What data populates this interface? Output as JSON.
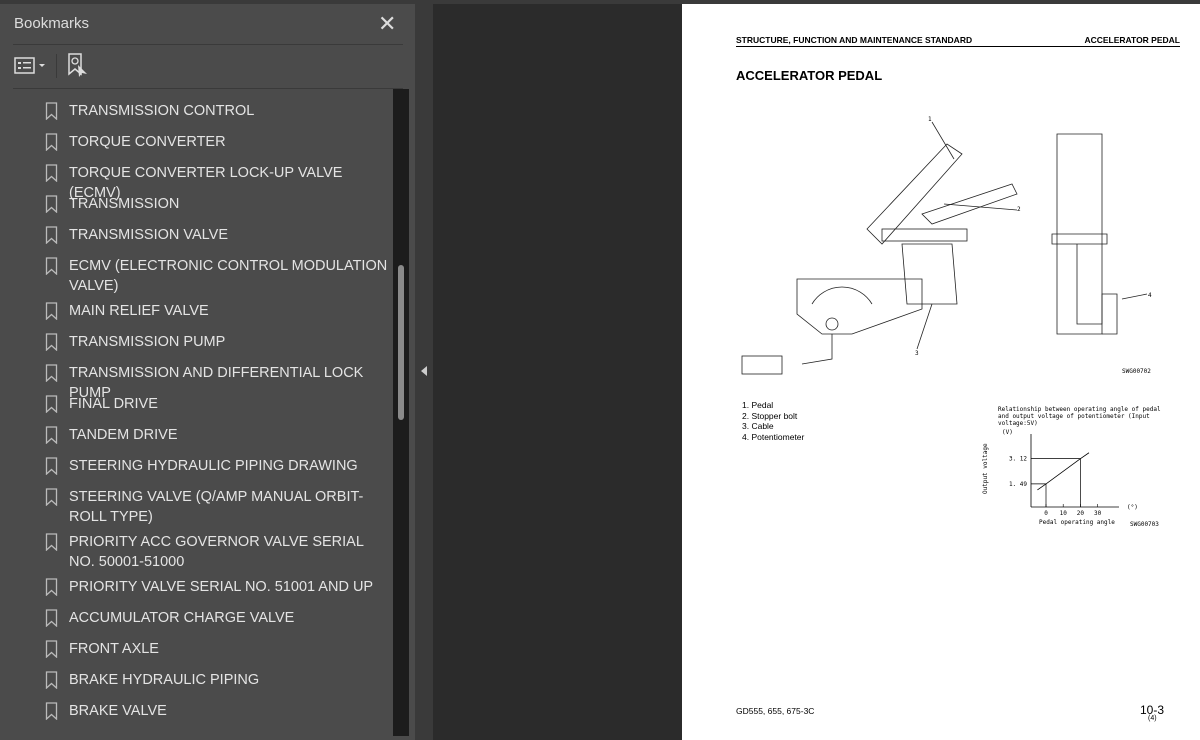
{
  "sidebar": {
    "title": "Bookmarks",
    "close": "✕",
    "items": [
      {
        "label": "TRANSMISSION CONTROL"
      },
      {
        "label": "TORQUE CONVERTER"
      },
      {
        "label": "TORQUE CONVERTER LOCK-UP VALVE (ECMV)"
      },
      {
        "label": "TRANSMISSION"
      },
      {
        "label": "TRANSMISSION VALVE"
      },
      {
        "label": "ECMV (ELECTRONIC CONTROL MODULATION VALVE)"
      },
      {
        "label": "MAIN RELIEF VALVE"
      },
      {
        "label": "TRANSMISSION PUMP"
      },
      {
        "label": "TRANSMISSION AND DIFFERENTIAL LOCK PUMP"
      },
      {
        "label": "FINAL DRIVE"
      },
      {
        "label": "TANDEM DRIVE"
      },
      {
        "label": "STEERING HYDRAULIC PIPING DRAWING"
      },
      {
        "label": "STEERING VALVE (Q/AMP MANUAL ORBIT-ROLL TYPE)"
      },
      {
        "label": "PRIORITY ACC GOVERNOR VALVE SERIAL NO. 50001-51000"
      },
      {
        "label": "PRIORITY VALVE SERIAL NO. 51001 AND UP"
      },
      {
        "label": "ACCUMULATOR CHARGE VALVE"
      },
      {
        "label": "FRONT AXLE"
      },
      {
        "label": "BRAKE HYDRAULIC PIPING"
      },
      {
        "label": "BRAKE VALVE"
      }
    ]
  },
  "page": {
    "header_left": "STRUCTURE, FUNCTION AND MAINTENANCE STANDARD",
    "header_right": "ACCELERATOR PEDAL",
    "title": "ACCELERATOR PEDAL",
    "callouts": [
      "1",
      "2",
      "3",
      "4"
    ],
    "figure1_code": "SWG00702",
    "parts": [
      "1. Pedal",
      "2. Stopper bolt",
      "3. Cable",
      "4. Potentiometer"
    ],
    "footer_model": "GD555, 655, 675-3C",
    "page_number": "10-3",
    "page_sub": "(4)"
  },
  "chart_data": {
    "type": "line",
    "title": "Relationship between operating angle of pedal and output voltage of potentiometer (Input voltage:5V)",
    "xlabel": "Pedal operating angle",
    "ylabel": "Output voltage",
    "x_unit": "(°)",
    "y_unit": "(V)",
    "x_ticks": [
      0,
      10,
      20,
      30
    ],
    "y_ticks": [
      1.49,
      3.12
    ],
    "series": [
      {
        "x": [
          -5,
          0,
          20,
          25
        ],
        "y": [
          1.1,
          1.49,
          3.12,
          3.5
        ]
      }
    ],
    "code": "SWG00703"
  }
}
